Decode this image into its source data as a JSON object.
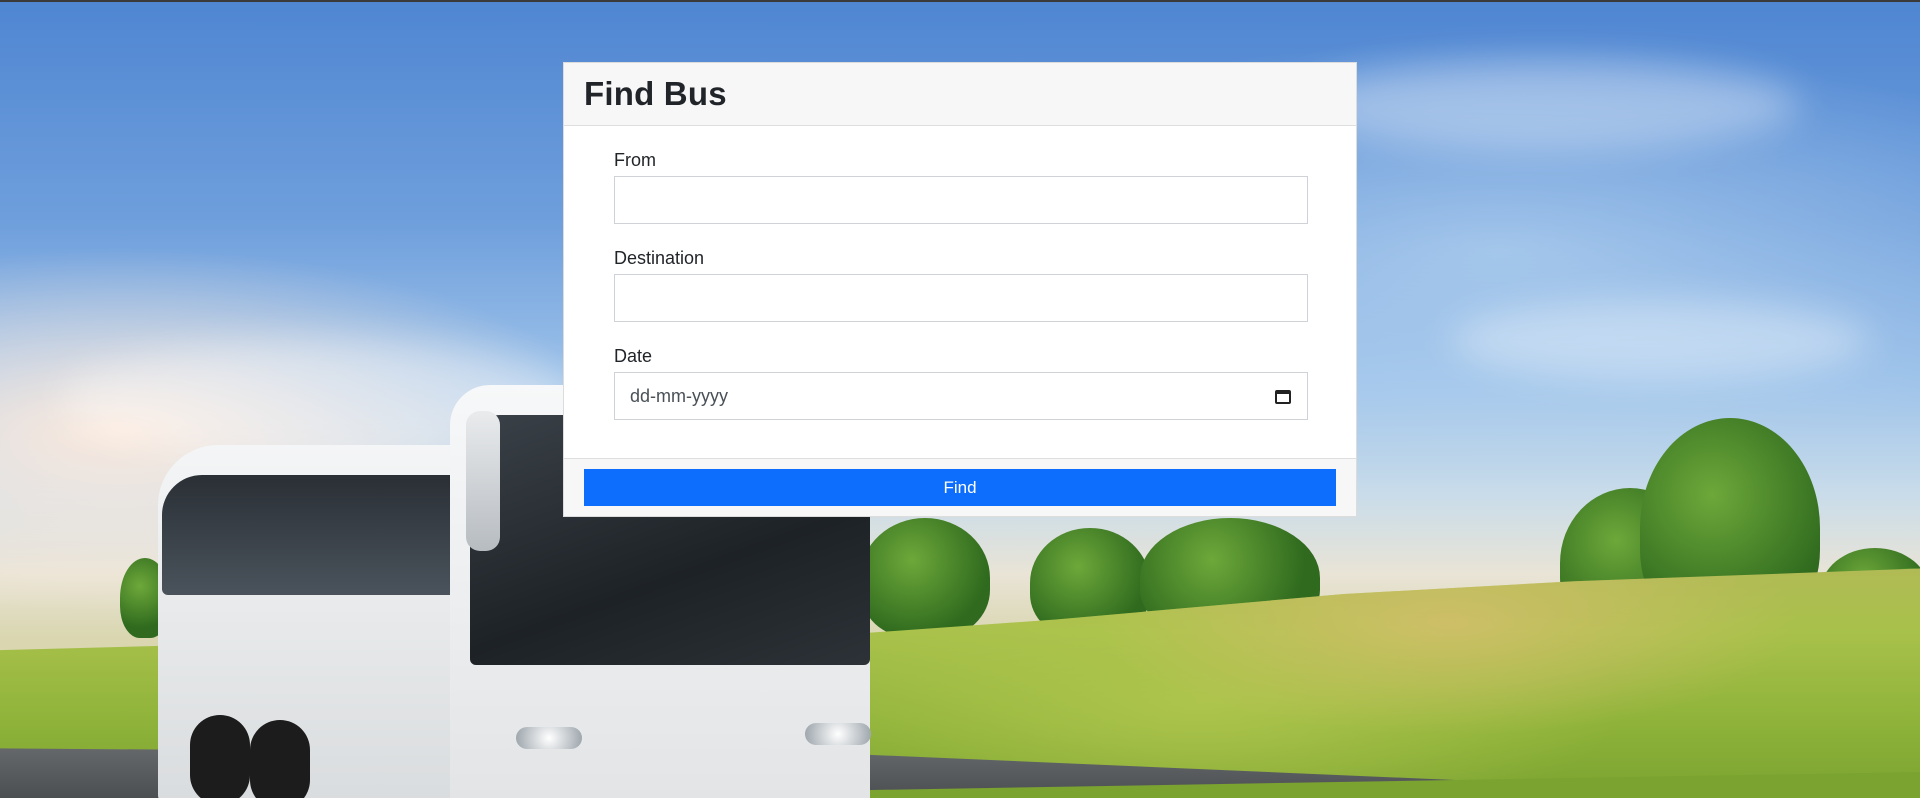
{
  "form": {
    "title": "Find Bus",
    "from_label": "From",
    "from_value": "",
    "destination_label": "Destination",
    "destination_value": "",
    "date_label": "Date",
    "date_placeholder": "dd-mm-yyyy",
    "date_icon": "calendar-icon",
    "submit_label": "Find"
  },
  "colors": {
    "button": "#0d6efd",
    "header_bg": "#f7f7f7"
  }
}
